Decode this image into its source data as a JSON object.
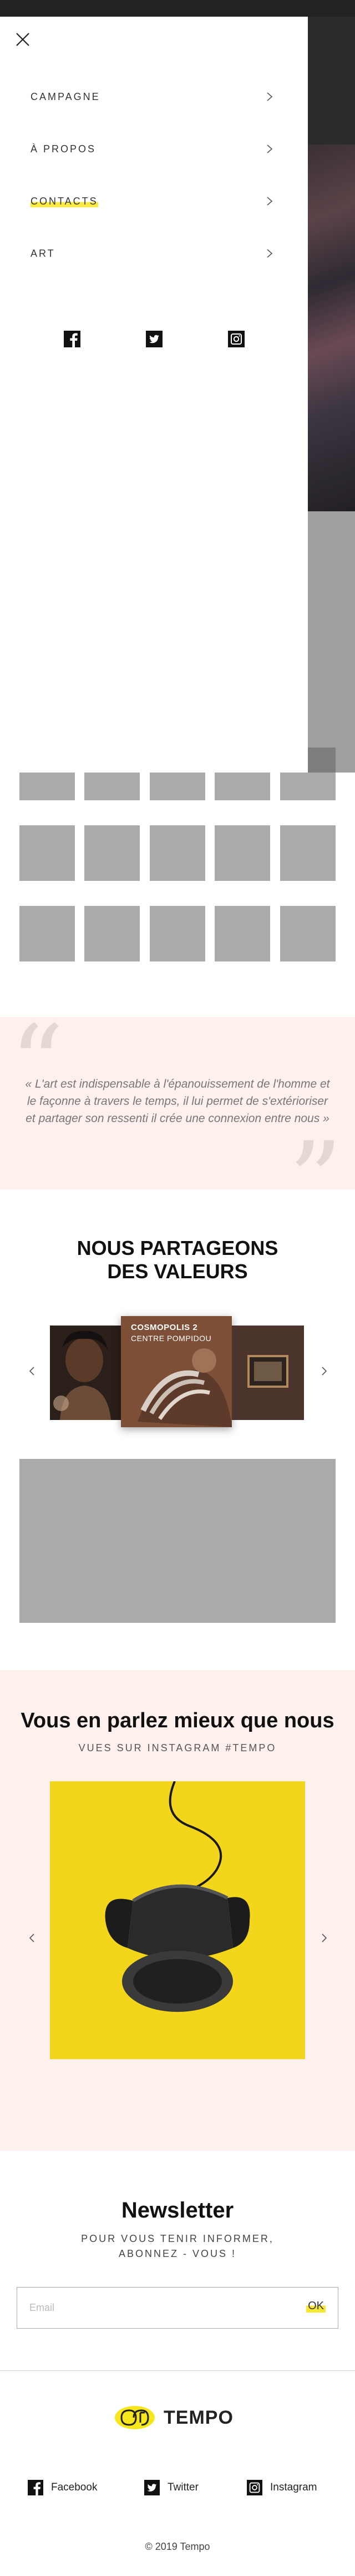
{
  "menu": {
    "items": [
      {
        "label": "CAMPAGNE"
      },
      {
        "label": "À PROPOS"
      },
      {
        "label": "CONTACTS"
      },
      {
        "label": "ART"
      }
    ],
    "social_icons": [
      "facebook-icon",
      "twitter-icon",
      "instagram-icon"
    ]
  },
  "quote": {
    "text": "« L'art est indispensable à l'épanouissement de l'homme et le façonne à travers le temps, il lui permet de s'extérioriser et partager son ressenti il crée une connexion entre nous »"
  },
  "values": {
    "title": "NOUS PARTAGEONS DES VALEURS",
    "cards": [
      {
        "title": "COSMOPOLIS 2",
        "subtitle": "CENTRE POMPIDOU"
      }
    ]
  },
  "instagram": {
    "title": "Vous en parlez mieux que nous",
    "subtitle": "VUES SUR INSTAGRAM #TEMPO"
  },
  "newsletter": {
    "title": "Newsletter",
    "subtitle": "POUR VOUS TENIR INFORMER, ABONNEZ - VOUS !",
    "placeholder": "Email",
    "submit_label": "OK"
  },
  "footer": {
    "brand": "TEMPO",
    "social": [
      {
        "label": "Facebook",
        "icon": "facebook-icon"
      },
      {
        "label": "Twitter",
        "icon": "twitter-icon"
      },
      {
        "label": "Instagram",
        "icon": "instagram-icon"
      }
    ],
    "copyright": "© 2019 Tempo"
  },
  "colors": {
    "accent_yellow": "#f6e61e",
    "section_pink": "#fdf0ed",
    "placeholder_gray": "#aaaaaa"
  }
}
